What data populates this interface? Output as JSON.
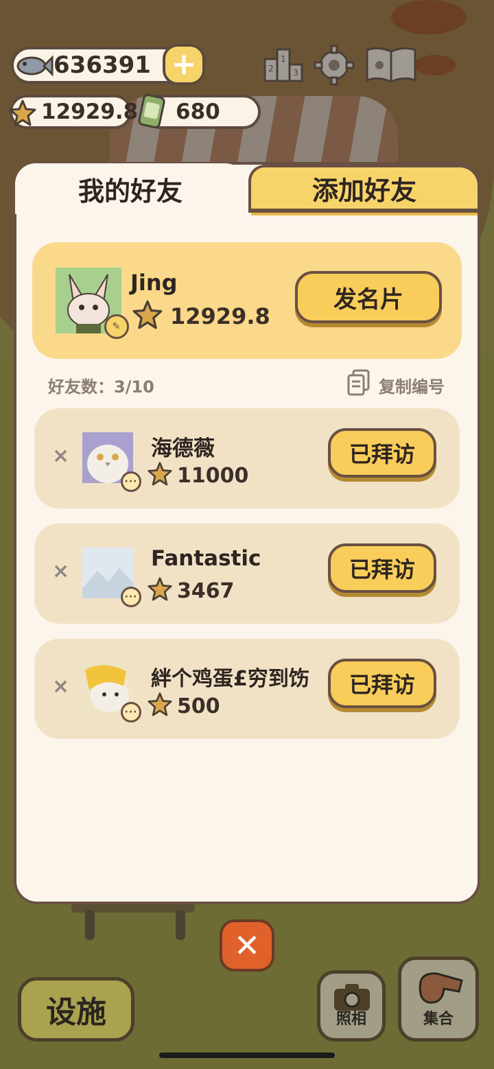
{
  "hud": {
    "fish_count": "636391",
    "plus_label": "+",
    "stars": "12929.8",
    "cans": "680",
    "icons": [
      "fish-icon",
      "star-icon",
      "can-icon",
      "ranking-icon",
      "gear-icon",
      "book-icon"
    ]
  },
  "tabs": {
    "my_friends": "我的好友",
    "add_friend": "添加好友"
  },
  "me": {
    "name": "Jing",
    "score": "12929.8",
    "send_card_label": "发名片"
  },
  "friend_count": "好友数：3/10",
  "copy_id_label": "复制编号",
  "friends": [
    {
      "name": "海德薇",
      "score": "11000",
      "button": "已拜访",
      "remove": "×",
      "more": "···"
    },
    {
      "name": "Fantastic",
      "score": "3467",
      "button": "已拜访",
      "remove": "×",
      "more": "···"
    },
    {
      "name": "絆个鸡蛋£穷到饬",
      "score": "500",
      "button": "已拜访",
      "remove": "×",
      "more": "···"
    }
  ],
  "close_label": "✕",
  "bottom": {
    "facility": "设施",
    "photo": "照相",
    "gather": "集合"
  },
  "colors": {
    "accent_yellow": "#f8cd5a",
    "panel": "#fcf5ec",
    "outline": "#6a5042",
    "close_orange": "#e0622a"
  }
}
